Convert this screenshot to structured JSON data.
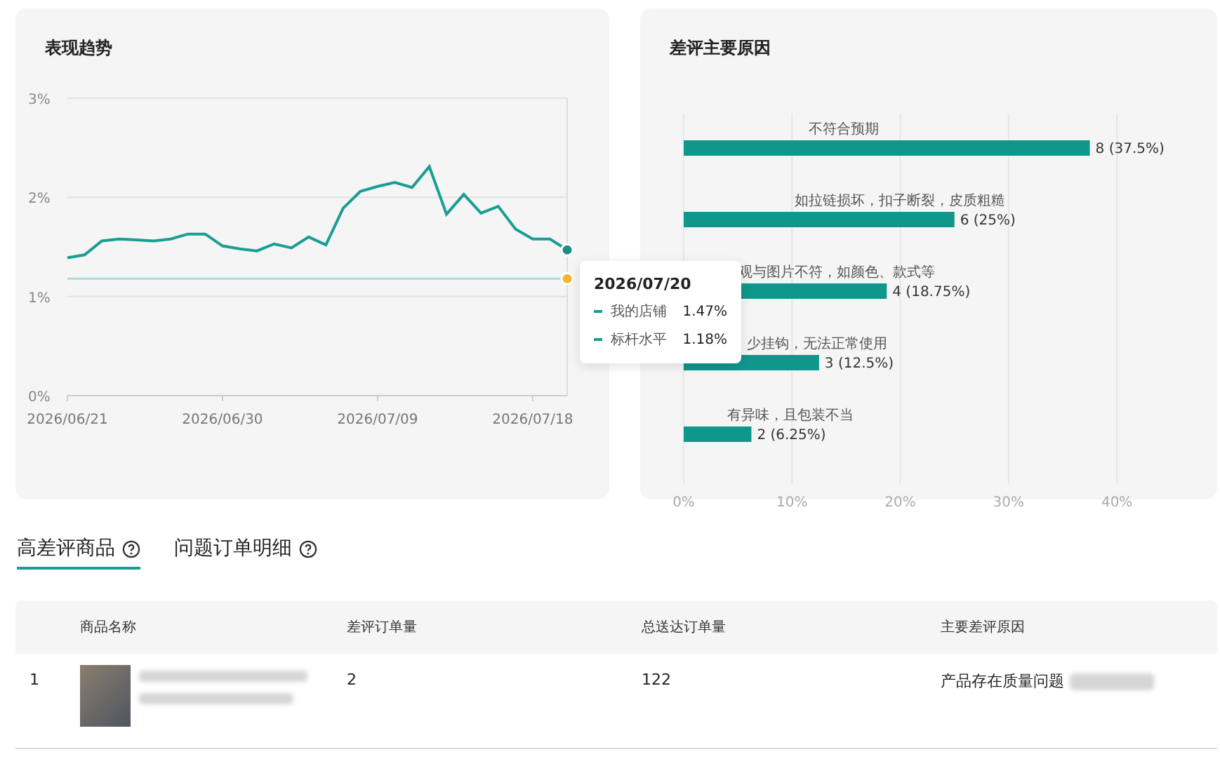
{
  "trend_card": {
    "title": "表现趋势",
    "chart_data": {
      "type": "line",
      "grid": true,
      "categories": [
        "2026/06/21",
        null,
        null,
        null,
        null,
        null,
        null,
        null,
        null,
        "2026/06/30",
        null,
        null,
        null,
        null,
        null,
        null,
        null,
        null,
        "2026/07/09",
        null,
        null,
        null,
        null,
        null,
        null,
        null,
        null,
        "2026/07/18",
        null,
        null
      ],
      "series": [
        {
          "name": "我的店铺",
          "color": "#1a9e94",
          "values": [
            1.39,
            1.42,
            1.56,
            1.58,
            1.57,
            1.56,
            1.58,
            1.63,
            1.63,
            1.51,
            1.48,
            1.46,
            1.53,
            1.49,
            1.6,
            1.52,
            1.89,
            2.06,
            2.11,
            2.15,
            2.1,
            2.31,
            1.83,
            2.03,
            1.84,
            1.91,
            1.68,
            1.58,
            1.58,
            1.47
          ]
        },
        {
          "name": "标杆水平",
          "color": "#a8dcd9",
          "values": [
            1.18,
            1.18,
            1.18,
            1.18,
            1.18,
            1.18,
            1.18,
            1.18,
            1.18,
            1.18,
            1.18,
            1.18,
            1.18,
            1.18,
            1.18,
            1.18,
            1.18,
            1.18,
            1.18,
            1.18,
            1.18,
            1.18,
            1.18,
            1.18,
            1.18,
            1.18,
            1.18,
            1.18,
            1.18,
            1.18
          ]
        }
      ],
      "ylim": [
        0,
        3
      ],
      "yticks": [
        {
          "value": 0,
          "label": "0%"
        },
        {
          "value": 1,
          "label": "1%"
        },
        {
          "value": 2,
          "label": "2%"
        },
        {
          "value": 3,
          "label": "3%"
        }
      ]
    },
    "tooltip": {
      "date": "2026/07/20",
      "values": [
        "1.47%",
        "1.18%"
      ]
    }
  },
  "reasons_card": {
    "title": "差评主要原因",
    "chart_data": {
      "type": "bar",
      "orientation": "horizontal",
      "grid": true,
      "categories": [
        "不符合预期",
        "如拉链损坏，扣子断裂，皮质粗糙",
        "观与图片不符，如颜色、款式等",
        "少挂钩，无法正常使用",
        "有异味，且包装不当"
      ],
      "values": [
        37.5,
        25,
        18.75,
        12.5,
        6.25
      ],
      "xlim": [
        0,
        49
      ],
      "xticks": [
        {
          "value": 0,
          "label": "0%"
        },
        {
          "value": 10,
          "label": "10%"
        },
        {
          "value": 20,
          "label": "20%"
        },
        {
          "value": 30,
          "label": "30%"
        },
        {
          "value": 40,
          "label": "40%"
        }
      ],
      "value_labels": [
        "8 (37.5%)",
        "6 (25%)",
        "4 (18.75%)",
        "3 (12.5%)",
        "2 (6.25%)"
      ]
    }
  },
  "tabs": [
    {
      "label": "高差评商品",
      "selected": true
    },
    {
      "label": "问题订单明细",
      "selected": false
    }
  ],
  "table": {
    "columns": [
      "商品名称",
      "差评订单量",
      "总送达订单量",
      "主要差评原因"
    ],
    "rows": [
      {
        "index": "1",
        "bad_orders": "2",
        "delivered_orders": "122",
        "main_reason": "产品存在质量问题"
      }
    ]
  }
}
